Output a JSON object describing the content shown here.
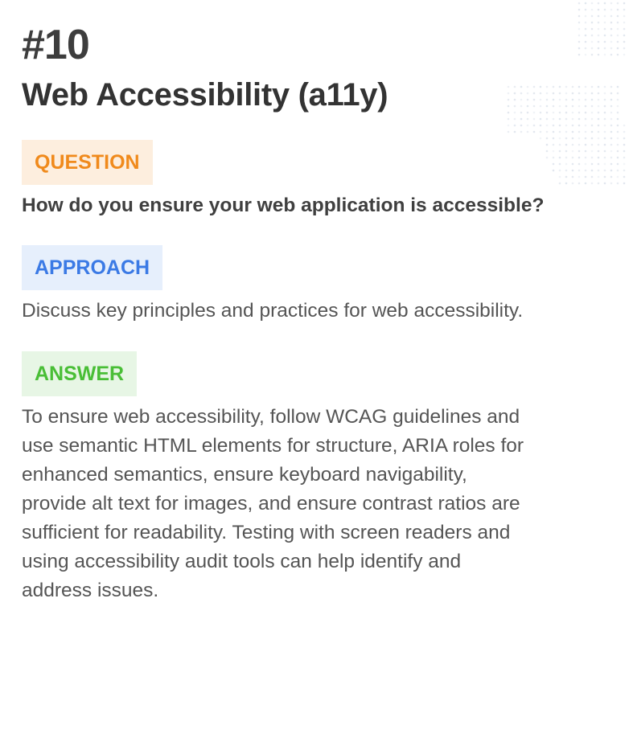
{
  "card": {
    "number": "#10",
    "title": "Web Accessibility (a11y)"
  },
  "question": {
    "label": "QUESTION",
    "text": "How do you ensure your web application is accessible?"
  },
  "approach": {
    "label": "APPROACH",
    "text": "Discuss key principles and practices for web accessibility."
  },
  "answer": {
    "label": "ANSWER",
    "lines": [
      "To ensure web accessibility, follow WCAG guidelines and",
      "use semantic HTML elements for structure, ARIA roles for",
      "enhanced semantics, ensure keyboard navigability,",
      "provide alt text for images, and ensure contrast ratios are",
      "sufficient for readability. Testing with screen readers and",
      "using accessibility audit tools can help identify and",
      "address issues."
    ]
  },
  "colors": {
    "question_accent": "#f08a1c",
    "question_bg": "#fdeede",
    "approach_accent": "#3b7ae5",
    "approach_bg": "#e6effc",
    "answer_accent": "#49be36",
    "answer_bg": "#e7f6e5"
  },
  "icons": {
    "background_decoration": "dot-pattern-icon"
  }
}
